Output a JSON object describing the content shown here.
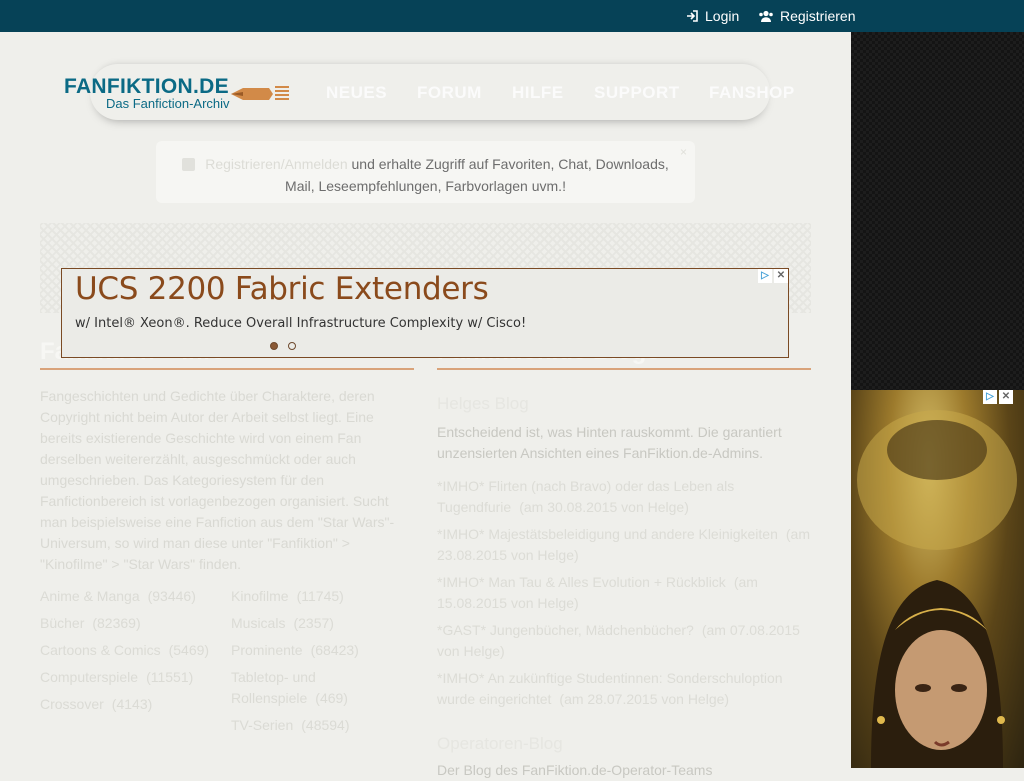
{
  "topbar": {
    "login_label": "Login",
    "register_label": "Registrieren"
  },
  "logo": {
    "title": "FANFIKTION.DE",
    "subtitle": "Das Fanfiction-Archiv"
  },
  "nav": [
    "NEUES",
    "FORUM",
    "HILFE",
    "SUPPORT",
    "FANSHOP"
  ],
  "notice": {
    "link_text": "Registrieren/Anmelden",
    "line1_rest": " und erhalte Zugriff auf Favoriten, Chat, Downloads,",
    "line2": "Mail, Leseempfehlungen, Farbvorlagen uvm.!",
    "close": "×"
  },
  "ad": {
    "headline": "UCS 2200 Fabric Extenders",
    "subline": "w/ Intel® Xeon®. Reduce Overall Infrastructure Complexity w/ Cisco!",
    "badge_info": "▷",
    "badge_close": "✕"
  },
  "left_section": {
    "title": "Fanfiktion – Info",
    "paragraph": "Fangeschichten und Gedichte über Charaktere, deren Copyright nicht beim Autor der Arbeit selbst liegt. Eine bereits existierende Geschichte wird von einem Fan derselben weitererzählt, ausgeschmückt oder auch umgeschrieben. Das Kategoriesystem für den Fanfictionbereich ist vorlagenbezogen organisiert. Sucht man beispielsweise eine Fanfiction aus dem \"Star Wars\"-Universum, so wird man diese unter \"Fanfiktion\" > \"Kinofilme\" > \"Star Wars\" finden.",
    "categories_col1": [
      {
        "name": "Anime & Manga",
        "count": "(93446)"
      },
      {
        "name": "Bücher",
        "count": "(82369)"
      },
      {
        "name": "Cartoons & Comics",
        "count": "(5469)"
      },
      {
        "name": "Computerspiele",
        "count": "(11551)"
      },
      {
        "name": "Crossover",
        "count": "(4143)"
      }
    ],
    "categories_col2": [
      {
        "name": "Kinofilme",
        "count": "(11745)"
      },
      {
        "name": "Musicals",
        "count": "(2357)"
      },
      {
        "name": "Prominente",
        "count": "(68423)"
      },
      {
        "name": "Tabletop- und Rollenspiele",
        "count": "(469)"
      },
      {
        "name": "TV-Serien",
        "count": "(48594)"
      }
    ]
  },
  "right_section": {
    "title": "Fanfiktion.de Blogs",
    "blog1_title": "Helges Blog",
    "blog1_desc": "Entscheidend ist, was Hinten rauskommt. Die garantiert unzensierten Ansichten eines FanFiktion.de-Admins.",
    "posts": [
      {
        "title": "*IMHO* Flirten (nach Bravo) oder das Leben als Tugendfurie",
        "date": "(am 30.08.2015 von Helge)"
      },
      {
        "title": "*IMHO* Majestätsbeleidigung und andere Kleinigkeiten",
        "date": "(am 23.08.2015 von Helge)"
      },
      {
        "title": "*IMHO* Man Tau & Alles Evolution + Rückblick",
        "date": "(am 15.08.2015 von Helge)"
      },
      {
        "title": "*GAST* Jungenbücher, Mädchenbücher?",
        "date": "(am 07.08.2015 von Helge)"
      },
      {
        "title": "*IMHO* An zukünftige Studentinnen: Sonderschuloption wurde eingerichtet",
        "date": "(am 28.07.2015 von Helge)"
      }
    ],
    "blog2_title": "Operatoren-Blog",
    "blog2_desc": "Der Blog des FanFiktion.de-Operator-Teams"
  },
  "colors": {
    "topbar": "#064257",
    "brand": "#0b6a85",
    "accent_rule": "#d9a37a",
    "ad_text": "#8a4a1c"
  }
}
